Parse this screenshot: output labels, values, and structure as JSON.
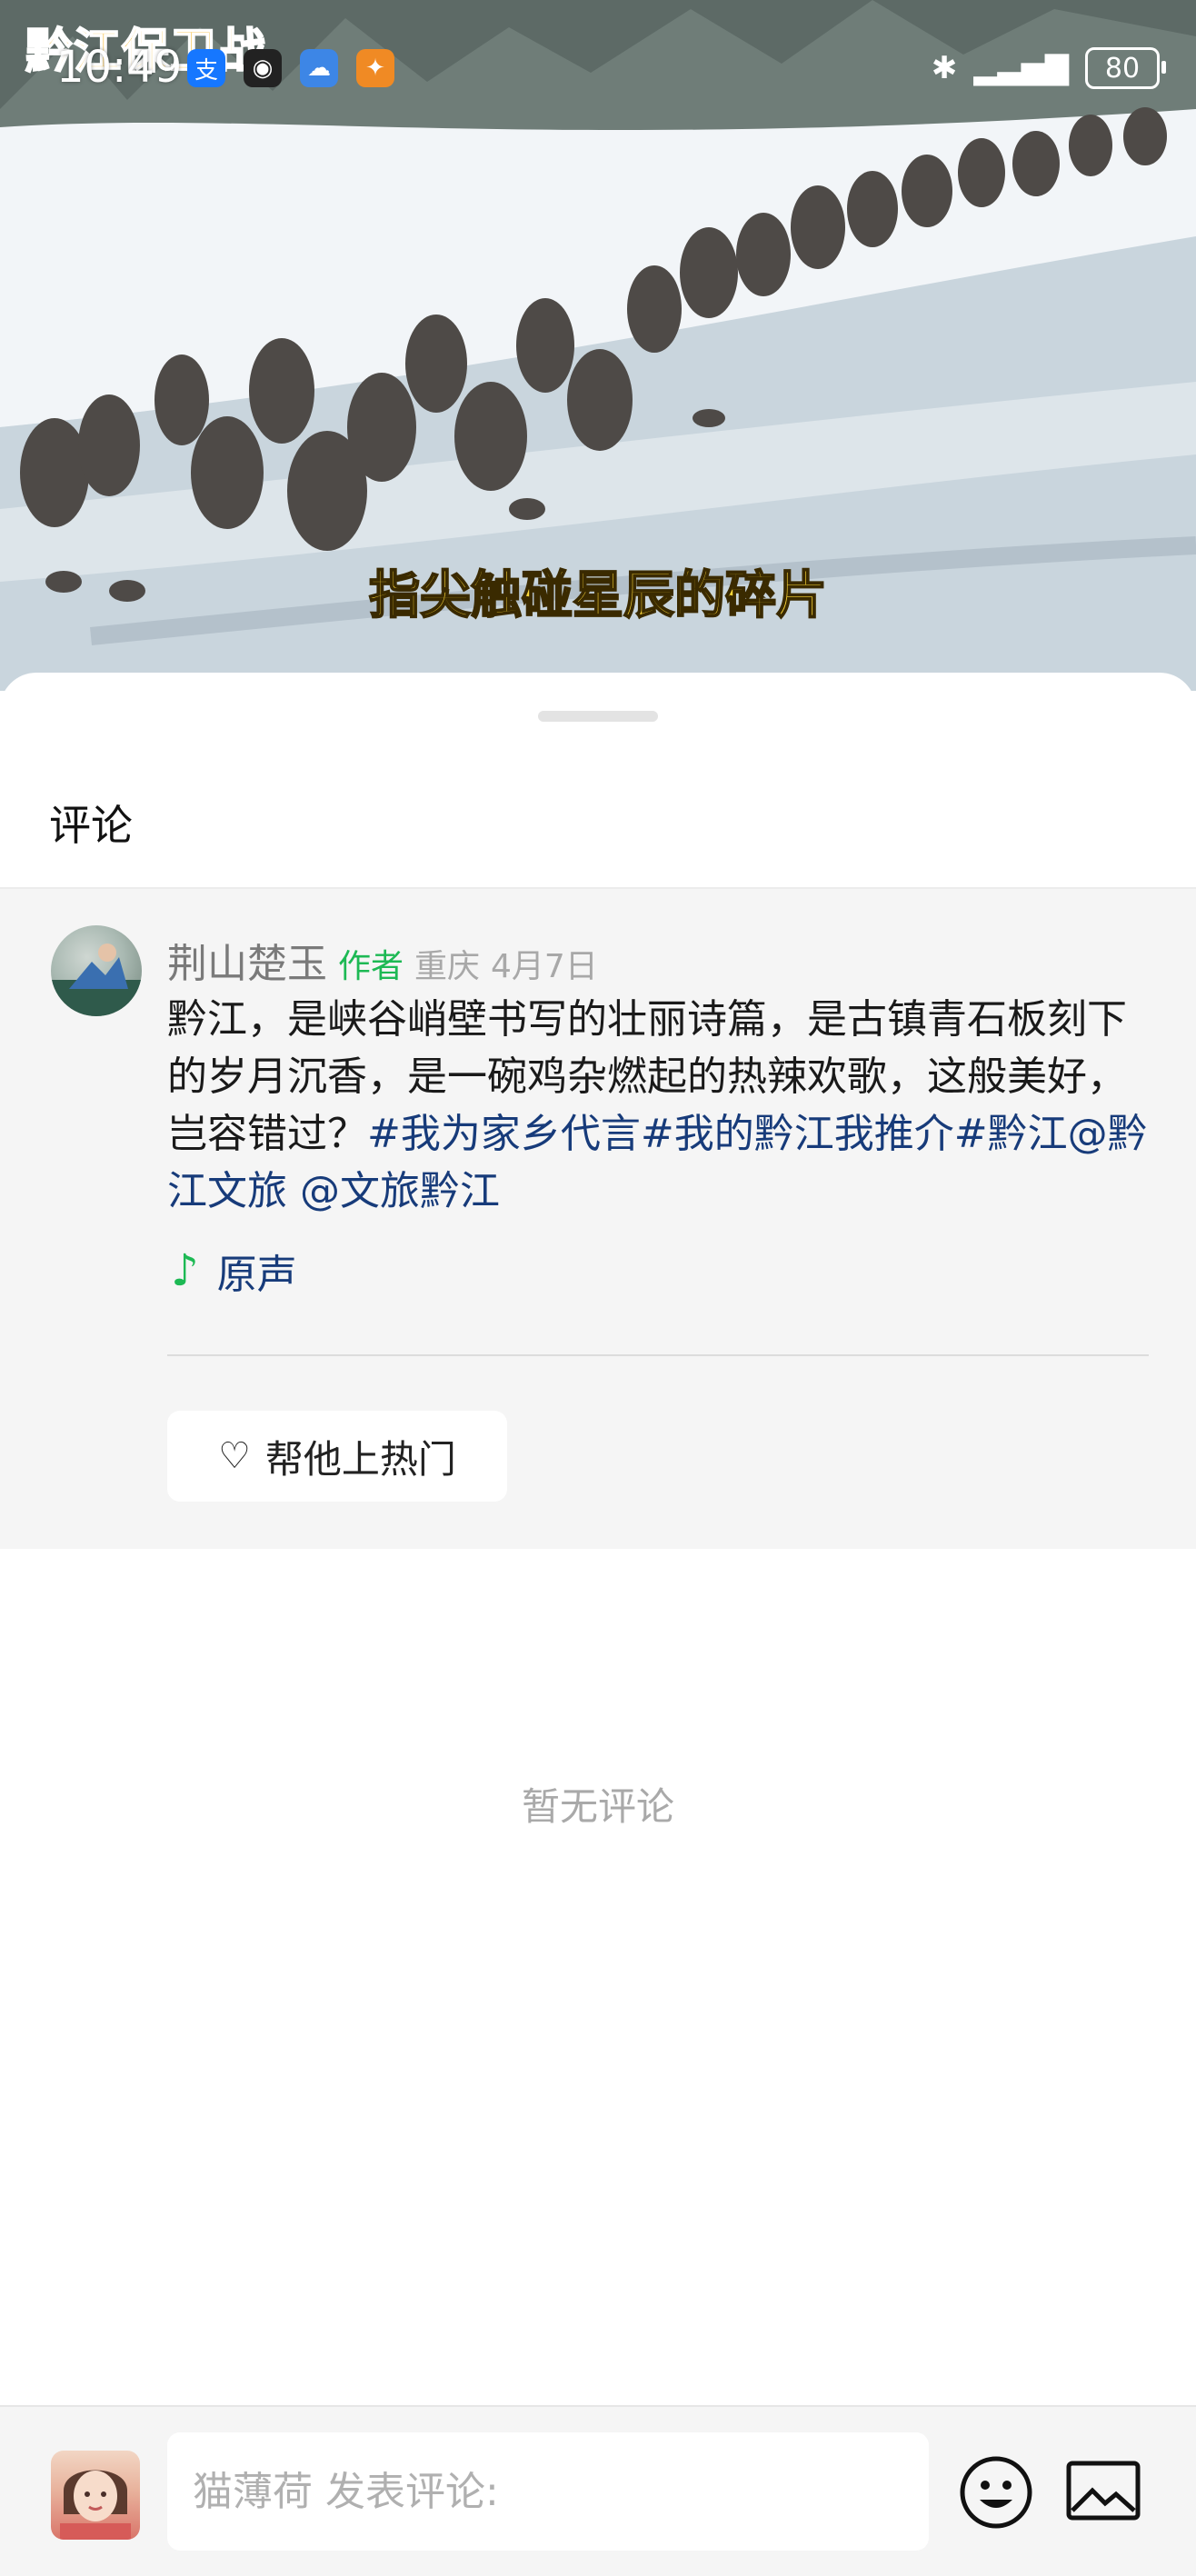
{
  "status_bar": {
    "time": "10:49",
    "watermark": "黔江保卫战",
    "battery": "80",
    "app_icons": [
      "alipay-icon",
      "qq-icon",
      "cloud-icon",
      "app-icon"
    ]
  },
  "video": {
    "subtitle": "指尖触碰星辰的碎片"
  },
  "sheet": {
    "title": "评论"
  },
  "post": {
    "author": "荆山楚玉",
    "author_tag": "作者",
    "location": "重庆",
    "date": "4月7日",
    "text_plain": "黔江，是峡谷峭壁书写的壮丽诗篇，是古镇青石板刻下的岁月沉香，是一碗鸡杂燃起的热辣欢歌，这般美好，岂容错过？",
    "tags": "#我为家乡代言#我的黔江我推介#黔江@黔江文旅 @文旅黔江",
    "music_label": "原声",
    "boost_label": "帮他上热门"
  },
  "empty_text": "暂无评论",
  "bottom_bar": {
    "placeholder": "猫薄荷 发表评论:"
  }
}
